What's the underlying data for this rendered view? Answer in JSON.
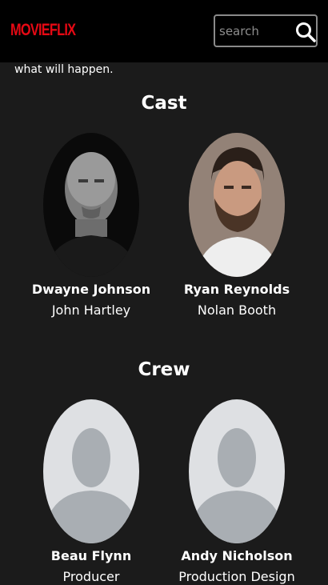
{
  "header": {
    "logo": "MOVIEFLIX",
    "search": {
      "placeholder": "search",
      "value": ""
    },
    "search_icon": "search-icon"
  },
  "overview_tail": "what will happen.",
  "cast": {
    "title": "Cast",
    "people": [
      {
        "name": "Dwayne Johnson",
        "role": "John Hartley"
      },
      {
        "name": "Ryan Reynolds",
        "role": "Nolan Booth"
      }
    ]
  },
  "crew": {
    "title": "Crew",
    "people": [
      {
        "name": "Beau Flynn",
        "role": "Producer"
      },
      {
        "name": "Andy Nicholson",
        "role": "Production Design"
      }
    ]
  },
  "colors": {
    "brand": "#e50914",
    "background": "#1b1b1b",
    "topbar": "#000000",
    "placeholder_bg": "#dee0e3",
    "placeholder_fg": "#a9aeb3"
  }
}
